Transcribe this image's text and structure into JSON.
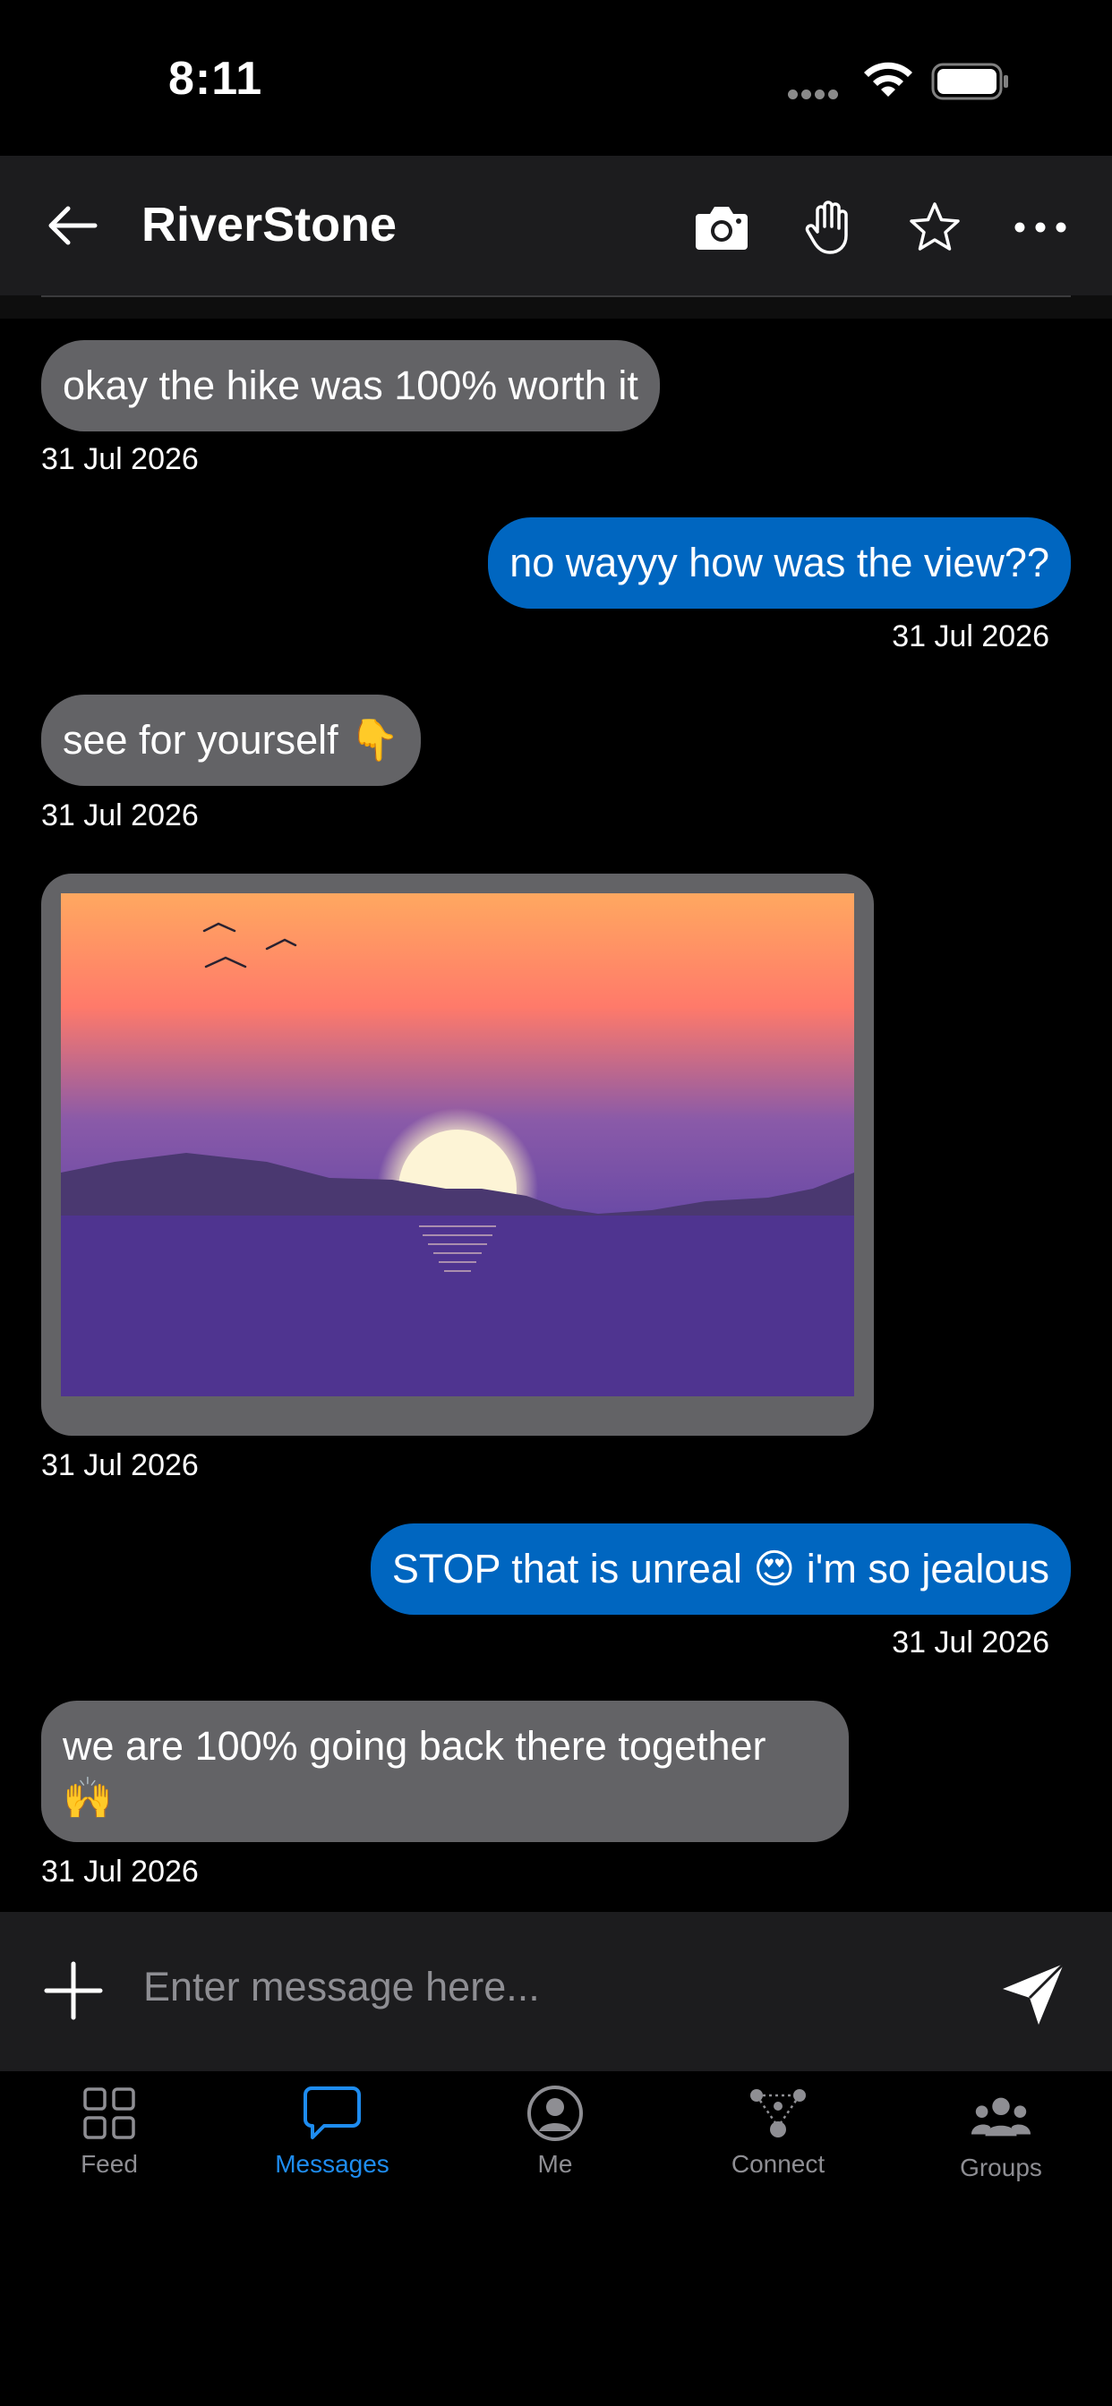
{
  "status": {
    "time": "8:11"
  },
  "header": {
    "title": "RiverStone",
    "icons": [
      "back-arrow-icon",
      "camera-icon",
      "hand-icon",
      "star-icon",
      "more-icon"
    ]
  },
  "messages": [
    {
      "direction": "in",
      "text": "okay the hike was 100% worth it",
      "date": "31 Jul 2026"
    },
    {
      "direction": "out",
      "text": "no wayyy how was the view??",
      "date": "31 Jul 2026"
    },
    {
      "direction": "in",
      "text": "see for yourself 👇",
      "date": "31 Jul 2026"
    },
    {
      "direction": "in",
      "type": "image",
      "image": "sunset-over-lake-photo",
      "date": "31 Jul 2026"
    },
    {
      "direction": "out",
      "text": "STOP that is unreal 😍 i'm so jealous",
      "date": "31 Jul 2026"
    },
    {
      "direction": "in",
      "text_line1": "we are 100% going back there together",
      "text_line2": "🙌",
      "date": "31 Jul 2026"
    }
  ],
  "composer": {
    "placeholder": "Enter message here..."
  },
  "tabs": [
    {
      "label": "Feed",
      "icon": "grid-icon",
      "active": false
    },
    {
      "label": "Messages",
      "icon": "chat-bubble-icon",
      "active": true
    },
    {
      "label": "Me",
      "icon": "profile-icon",
      "active": false
    },
    {
      "label": "Connect",
      "icon": "network-icon",
      "active": false
    },
    {
      "label": "Groups",
      "icon": "groups-icon",
      "active": false
    }
  ],
  "colors": {
    "incoming_bubble": "#636366",
    "outgoing_bubble": "#0066c0",
    "active_tab": "#1e8cf0",
    "header_bg": "#1c1c1e"
  }
}
